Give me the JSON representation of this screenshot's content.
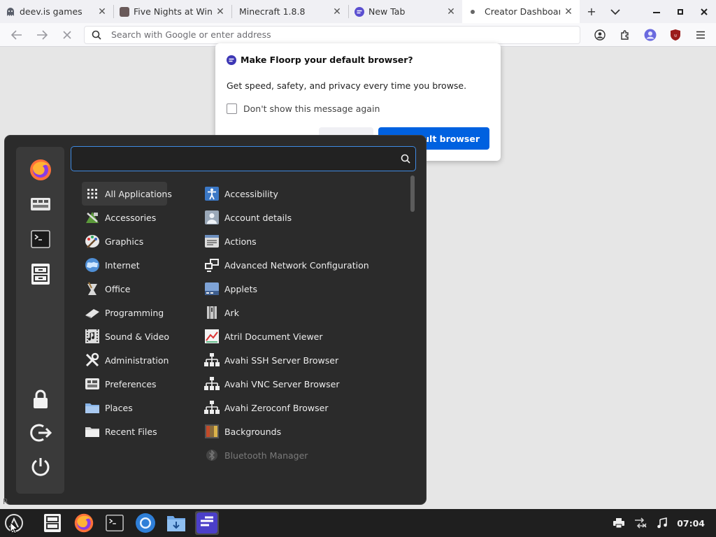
{
  "browser": {
    "tabs": [
      {
        "title": "deev.is games",
        "favicon": "ghost-icon",
        "color": "#5a5f6b"
      },
      {
        "title": "Five Nights at Winst",
        "favicon": "image-icon",
        "color": "#6a5a5a"
      },
      {
        "title": "Minecraft 1.8.8",
        "favicon": "none",
        "color": "#cccccc"
      },
      {
        "title": "New Tab",
        "favicon": "floorp-icon",
        "color": "#5b4fd0"
      },
      {
        "title": "Creator Dashboard",
        "favicon": "dot-icon",
        "color": "#666666",
        "active": true
      }
    ],
    "urlbar_placeholder": "Search with Google or enter address"
  },
  "dialog": {
    "title": "Make Floorp your default browser?",
    "message": "Get speed, safety, and privacy every time you browse.",
    "checkbox_label": "Don't show this message again",
    "primary_button": "efault browser"
  },
  "menu": {
    "search_value": "",
    "favorites": [
      "firefox-icon",
      "control-center-icon",
      "terminal-icon",
      "file-manager-icon"
    ],
    "session": [
      "lock-screen-icon",
      "logout-icon",
      "shutdown-icon"
    ],
    "categories": [
      {
        "label": "All Applications",
        "icon": "grid-icon",
        "selected": true
      },
      {
        "label": "Accessories",
        "icon": "accessories-icon"
      },
      {
        "label": "Graphics",
        "icon": "graphics-icon"
      },
      {
        "label": "Internet",
        "icon": "internet-icon"
      },
      {
        "label": "Office",
        "icon": "office-icon"
      },
      {
        "label": "Programming",
        "icon": "programming-icon"
      },
      {
        "label": "Sound & Video",
        "icon": "sound-video-icon"
      },
      {
        "label": "Administration",
        "icon": "administration-icon"
      },
      {
        "label": "Preferences",
        "icon": "preferences-icon"
      },
      {
        "label": "Places",
        "icon": "folder-icon"
      },
      {
        "label": "Recent Files",
        "icon": "recent-files-icon"
      }
    ],
    "applications": [
      {
        "label": "Accessibility",
        "icon": "accessibility-icon"
      },
      {
        "label": "Account details",
        "icon": "account-icon"
      },
      {
        "label": "Actions",
        "icon": "actions-icon"
      },
      {
        "label": "Advanced Network Configuration",
        "icon": "network-icon"
      },
      {
        "label": "Applets",
        "icon": "applets-icon"
      },
      {
        "label": "Ark",
        "icon": "ark-icon"
      },
      {
        "label": "Atril Document Viewer",
        "icon": "document-viewer-icon"
      },
      {
        "label": "Avahi SSH Server Browser",
        "icon": "avahi-icon"
      },
      {
        "label": "Avahi VNC Server Browser",
        "icon": "avahi-icon"
      },
      {
        "label": "Avahi Zeroconf Browser",
        "icon": "avahi-icon"
      },
      {
        "label": "Backgrounds",
        "icon": "backgrounds-icon"
      },
      {
        "label": "Bluetooth Manager",
        "icon": "bluetooth-icon",
        "dim": true
      }
    ]
  },
  "taskbar": {
    "clock": "07:04",
    "status_fragment": "R"
  },
  "colors": {
    "accent": "#0061e0",
    "menu_bg": "#2b2b2b",
    "taskbar_bg": "#1f1f1f"
  }
}
